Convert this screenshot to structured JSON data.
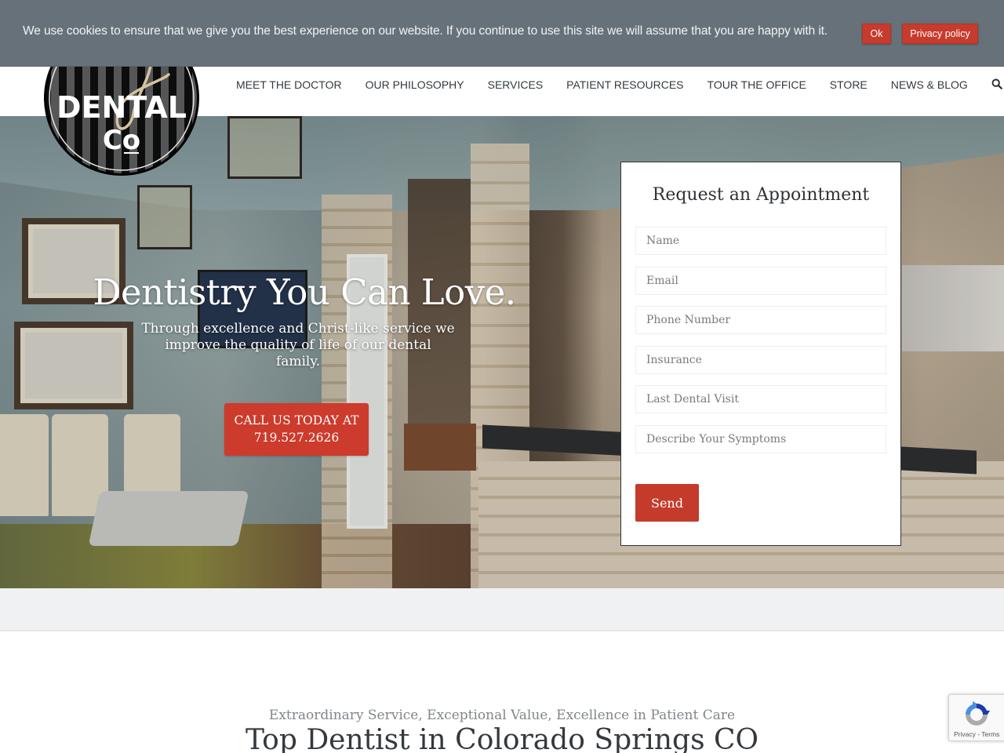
{
  "cookie_bar": {
    "message": "We use cookies to ensure that we give you the best experience on our website. If you continue to use this site we will assume that you are happy with it.",
    "ok_label": "Ok",
    "privacy_label": "Privacy policy"
  },
  "brand": {
    "logo_script": "My",
    "logo_line1": "DENTAL",
    "logo_line2": "Co",
    "logo_alt": "My Dental Co"
  },
  "nav": {
    "items": [
      {
        "label": "MEET THE DOCTOR"
      },
      {
        "label": "OUR PHILOSOPHY"
      },
      {
        "label": "SERVICES"
      },
      {
        "label": "PATIENT RESOURCES"
      },
      {
        "label": "TOUR THE OFFICE"
      },
      {
        "label": "STORE"
      },
      {
        "label": "NEWS & BLOG"
      }
    ],
    "search_icon": "search-icon"
  },
  "hero": {
    "title": "Dentistry You Can Love.",
    "subtitle": "Through excellence and Christ-like service we improve the quality of life of our dental family.",
    "cta_line1": "CALL US TODAY AT",
    "cta_line2": "719.527.2626"
  },
  "appointment_form": {
    "title": "Request an Appointment",
    "fields": [
      {
        "placeholder": "Name",
        "value": ""
      },
      {
        "placeholder": "Email",
        "value": ""
      },
      {
        "placeholder": "Phone Number",
        "value": ""
      },
      {
        "placeholder": "Insurance",
        "value": ""
      },
      {
        "placeholder": "Last Dental Visit",
        "value": ""
      },
      {
        "placeholder": "Describe Your Symptoms",
        "value": ""
      }
    ],
    "submit_label": "Send"
  },
  "intro": {
    "tagline": "Extraordinary Service,  Exceptional Value, Excellence in Patient Care",
    "heading": "Top Dentist in Colorado Springs CO"
  },
  "recaptcha": {
    "links": "Privacy - Terms"
  },
  "colors": {
    "accent_red": "#c73b2d",
    "cookie_bar_bg": "#667179",
    "nav_text": "#333a3f",
    "band_bg": "#f0f1f2"
  }
}
